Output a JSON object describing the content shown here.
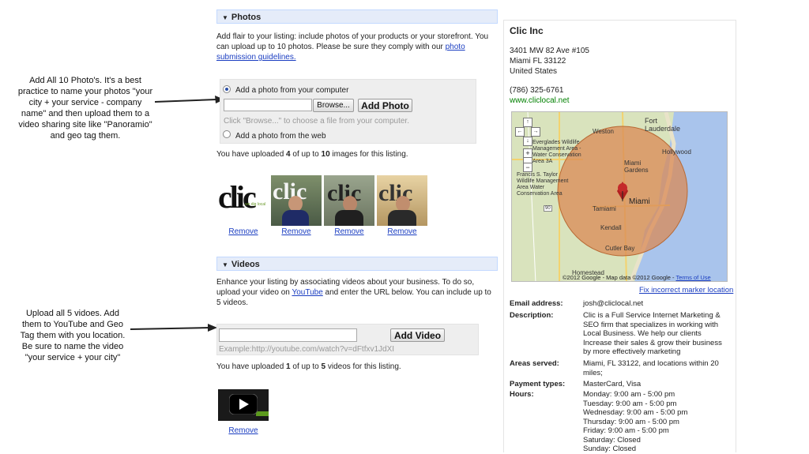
{
  "annotations": {
    "photos_note": "Add All 10 Photo's. It's a best practice to name your photos \"your city + your service - company name\" and then upload them to a video sharing site like \"Panoramio\" and geo tag them.",
    "videos_note": "Upload all 5 vidoes. Add them to YouTube and Geo Tag them with you location. Be sure to name the video \"your service + your city\""
  },
  "photos": {
    "section_title": "Photos",
    "intro_text": "Add flair to your listing: include photos of your products or your storefront. You can upload up to 10 photos. Please be sure they comply with our ",
    "guidelines_link": "photo submission guidelines.",
    "option_computer": "Add a photo from your computer",
    "browse_label": "Browse...",
    "add_photo_label": "Add Photo",
    "hint": "Click \"Browse...\" to choose a file from your computer.",
    "option_web": "Add a photo from the web",
    "uploaded_prefix": "You have uploaded ",
    "uploaded_count": "4",
    "uploaded_mid": " of up to ",
    "uploaded_max": "10",
    "uploaded_suffix": " images for this listing.",
    "remove_label": "Remove",
    "logo_text": "clic",
    "logo_small": "we dig local"
  },
  "videos": {
    "section_title": "Videos",
    "intro_text": "Enhance your listing by associating videos about your business. To do so, upload your video on ",
    "youtube_link": "YouTube",
    "intro_text2": " and enter the URL below. You can include up to 5 videos.",
    "url_value": "",
    "add_video_label": "Add Video",
    "example": "Example:http://youtube.com/watch?v=dFtfxv1JdXI",
    "uploaded_prefix": "You have uploaded ",
    "uploaded_count": "1",
    "uploaded_mid": " of up to ",
    "uploaded_max": "5",
    "uploaded_suffix": " videos for this listing.",
    "remove_label": "Remove"
  },
  "business": {
    "name": "Clic Inc",
    "address1": "3401 MW 82 Ave #105",
    "address2": "Miami FL 33122",
    "country": "United States",
    "phone": "(786) 325-6761",
    "website": "www.cliclocal.net"
  },
  "map": {
    "labels": {
      "fort_lauderdale": "Fort Lauderdale",
      "weston": "Weston",
      "hollywood": "Hollywood",
      "miami_gardens": "Miami Gardens",
      "everglades": "Everglades Wildlife Management Area - Water Conservation Area 3A",
      "francis": "Francis S. Taylor Wildlife Management Area Water Conservation Area",
      "tamiami": "Tamiami",
      "miami": "Miami",
      "kendall": "Kendall",
      "cutler_bay": "Cutler Bay",
      "homestead": "Homestead",
      "route_90": "90"
    },
    "copyright": "©2012 Google - Map data ©2012 Google - ",
    "terms": "Terms of Use",
    "fix_marker": "Fix incorrect marker location"
  },
  "details": {
    "email_label": "Email address:",
    "email_value": "josh@cliclocal.net",
    "description_label": "Description:",
    "description_value": "Clic is a Full Service Internet Marketing & SEO firm that specializes in working with Local Business. We help our clients Increase their sales & grow their business by more effectively marketing",
    "areas_label": "Areas served:",
    "areas_value": "Miami, FL 33122, and locations within 20 miles;",
    "payment_label": "Payment types:",
    "payment_value": "MasterCard, Visa",
    "hours_label": "Hours:",
    "hours": [
      "Monday: 9:00 am - 5:00 pm",
      "Tuesday: 9:00 am - 5:00 pm",
      "Wednesday: 9:00 am - 5:00 pm",
      "Thursday: 9:00 am - 5:00 pm",
      "Friday: 9:00 am - 5:00 pm",
      "Saturday: Closed",
      "Sunday: Closed"
    ]
  },
  "colors": {
    "section_bar": "#e5ecf9",
    "link": "#1a3dc1",
    "url_green": "#008000",
    "radius_fill": "#d98a55"
  }
}
